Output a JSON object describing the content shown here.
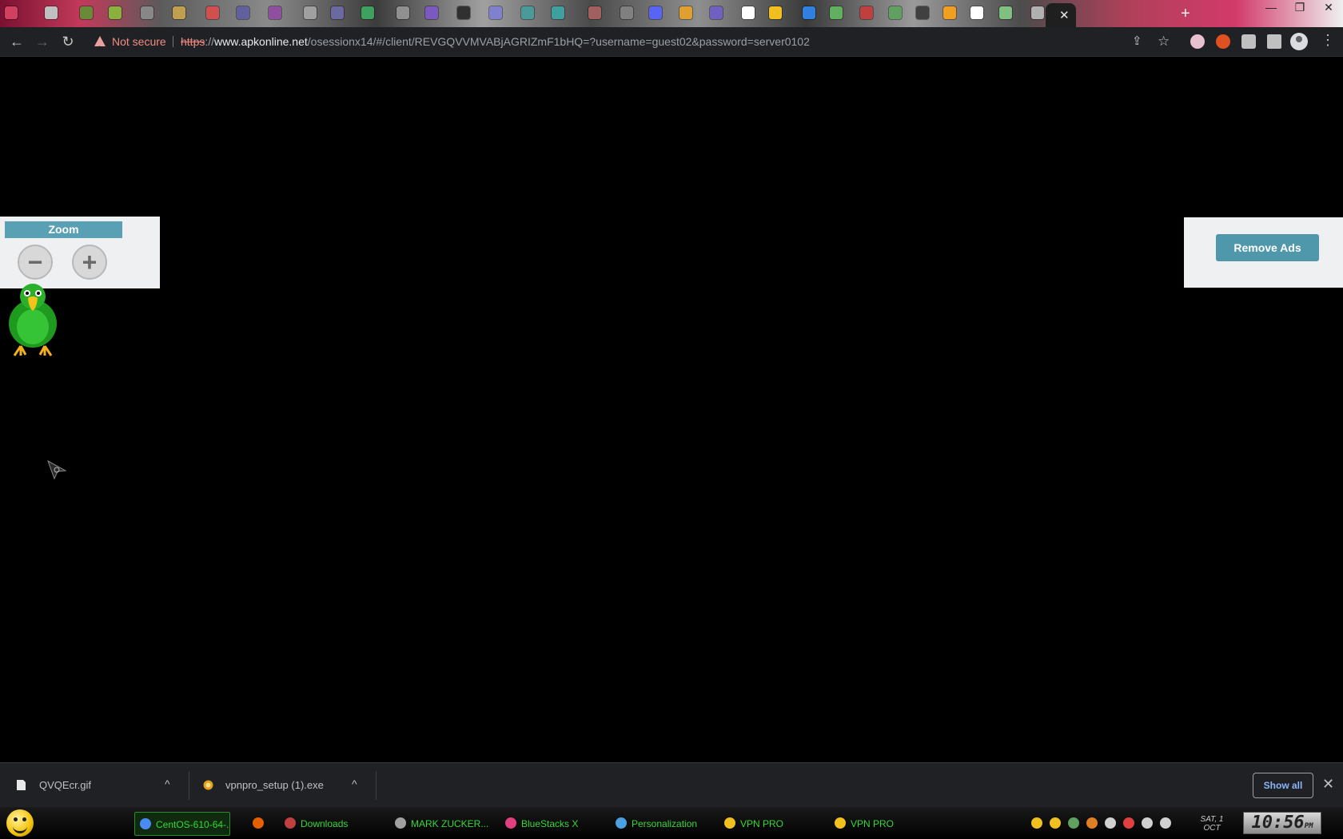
{
  "browser": {
    "tab_icon_colors": [
      "#d04060",
      "#c0c0c0",
      "#6a8a3a",
      "#8ab040",
      "#888",
      "#c0a050",
      "#d05050",
      "#6060a0",
      "#9050a0",
      "#a0a0a0",
      "#6a6aa0",
      "#40a060",
      "#909090",
      "#7a5ac0",
      "#303030",
      "#8080d0",
      "#4a9a9a",
      "#40a0a0",
      "#a06060",
      "#808080",
      "#5865f2",
      "#e0a030",
      "#7060c0",
      "#ffffff",
      "#f0c020",
      "#3080e0",
      "#60b060",
      "#c04040",
      "#60a060",
      "#404040",
      "#f0a020",
      "#ffffff",
      "#80c080",
      "#b0b0b0"
    ],
    "active_tab_close": "✕",
    "new_tab": "+",
    "window_controls": [
      "—",
      "❐",
      "✕"
    ],
    "nav": {
      "back_icon": "←",
      "forward_icon": "→",
      "reload_icon": "↻"
    },
    "security_label": "Not secure",
    "url_scheme": "https",
    "url_sep": "://",
    "url_host": "www.apkonline.net",
    "url_path": "/osessionx14/#/client/REVGQVVMVABjAGRIZmF1bHQ=?username=guest02&password=server0102",
    "share_icon": "⇪",
    "star_icon": "☆",
    "extension_colors": [
      "#e8c0d0",
      "#e05020",
      "#c0c0c0",
      "#c0c0c0"
    ],
    "menu_icon": "⋮"
  },
  "page": {
    "zoom_title": "Zoom",
    "zoom_out_symbol": "−",
    "zoom_in_symbol": "+",
    "remove_ads_label": "Remove Ads"
  },
  "downloads": {
    "items": [
      {
        "name": "QVQEcr.gif"
      },
      {
        "name": "vpnpro_setup (1).exe"
      }
    ],
    "caret": "^",
    "show_all_label": "Show all",
    "close_icon": "✕"
  },
  "taskbar": {
    "buttons": [
      {
        "label": "CentOS-610-64-...",
        "icon_color": "#4a8af4",
        "active": true
      },
      {
        "label": "",
        "icon_color": "#e66000",
        "active": false
      },
      {
        "label": "Downloads",
        "icon_color": "#c04040",
        "active": false
      },
      {
        "label": "MARK ZUCKER...",
        "icon_color": "#a0a0a0",
        "active": false
      },
      {
        "label": "BlueStacks X",
        "icon_color": "#e04080",
        "active": false
      },
      {
        "label": "Personalization",
        "icon_color": "#4aa0e0",
        "active": false
      },
      {
        "label": "VPN PRO",
        "icon_color": "#f0c020",
        "active": false
      },
      {
        "label": "VPN PRO",
        "icon_color": "#f0c020",
        "active": false
      }
    ],
    "tray_icon_colors": [
      "#f0c020",
      "#f0c020",
      "#60a060",
      "#e08020",
      "#d0d0d0",
      "#e04040",
      "#d0d0d0",
      "#d0d0d0"
    ],
    "date_day": "SAT, 1",
    "date_month": "OCT",
    "time": "10:56",
    "ampm": "PM"
  }
}
